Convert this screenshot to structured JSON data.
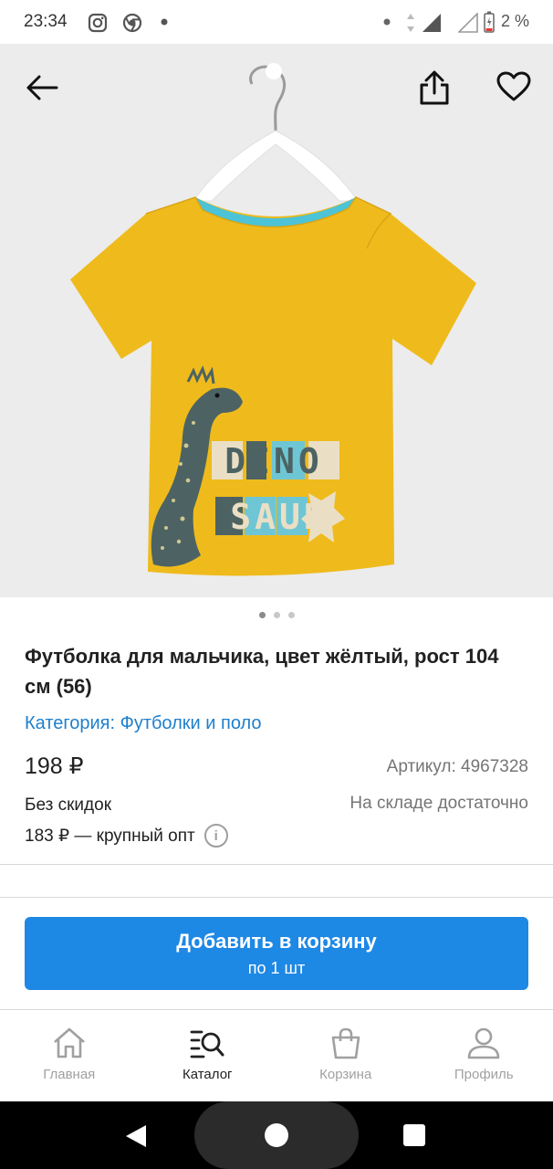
{
  "status_bar": {
    "time": "23:34",
    "battery": "2 %",
    "icons": [
      "instagram-icon",
      "chrome-icon",
      "dot-icon",
      "signal-icon",
      "battery-icon"
    ]
  },
  "gallery": {
    "back_icon": "arrow-left-icon",
    "share_icon": "share-icon",
    "favorite_icon": "heart-outline-icon",
    "print_text": [
      "DINO",
      "SAUR"
    ],
    "page_count": 3,
    "active_page": 0
  },
  "product": {
    "title": "Футболка для мальчика, цвет жёлтый, рост 104 см (56)",
    "category_label": "Категория: ",
    "category_value": "Футболки и поло",
    "price": "198 ₽",
    "article": "Артикул: 4967328",
    "discount": "Без скидок",
    "stock": "На складе достаточно",
    "wholesale": "183 ₽ — крупный опт",
    "info_icon": "i"
  },
  "cart_button": {
    "label": "Добавить в корзину",
    "sublabel": "по 1 шт"
  },
  "bottom_nav": {
    "items": [
      {
        "label": "Главная",
        "icon": "home-icon",
        "active": false
      },
      {
        "label": "Каталог",
        "icon": "catalog-search-icon",
        "active": true
      },
      {
        "label": "Корзина",
        "icon": "cart-bag-icon",
        "active": false
      },
      {
        "label": "Профиль",
        "icon": "profile-icon",
        "active": false
      }
    ]
  },
  "colors": {
    "accent": "#1e88e5",
    "link": "#1e7fcc",
    "shirt_yellow": "#efbb1c",
    "shirt_collar": "#4cc3d6",
    "dino": "#4d6363"
  }
}
